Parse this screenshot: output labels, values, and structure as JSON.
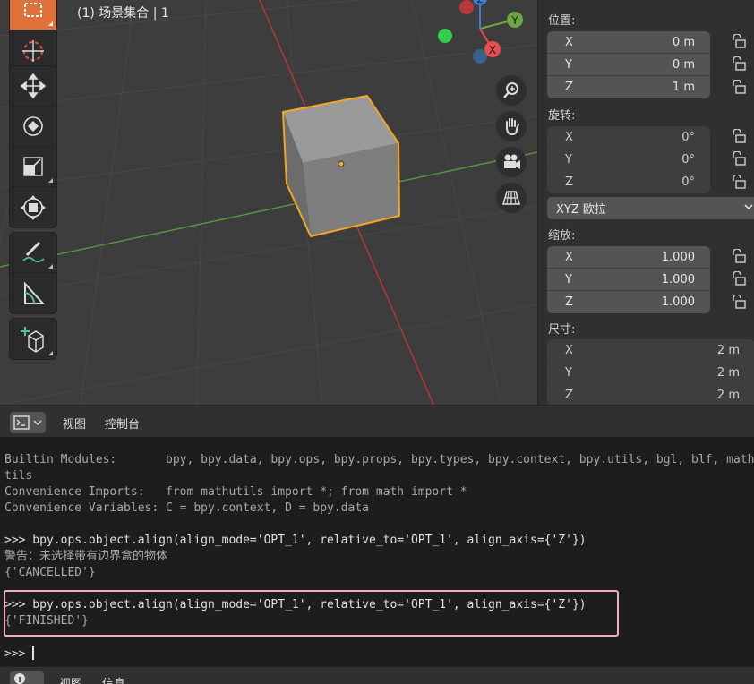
{
  "viewport": {
    "collection_label": "(1) 场景集合 | 1",
    "gizmo": {
      "x_label": "X",
      "y_label": "Y",
      "z_label": "Z"
    },
    "tools": [
      "select-box",
      "cursor",
      "move",
      "rotate",
      "scale",
      "transform",
      "annotate",
      "measure",
      "add-cube"
    ],
    "active_tool": "select-box",
    "nav_buttons": [
      "zoom",
      "pan",
      "camera",
      "perspective-toggle"
    ]
  },
  "properties": {
    "location": {
      "label": "位置:",
      "rows": [
        {
          "axis": "X",
          "value": "0 m"
        },
        {
          "axis": "Y",
          "value": "0 m"
        },
        {
          "axis": "Z",
          "value": "1 m"
        }
      ]
    },
    "rotation": {
      "label": "旋转:",
      "rows": [
        {
          "axis": "X",
          "value": "0°"
        },
        {
          "axis": "Y",
          "value": "0°"
        },
        {
          "axis": "Z",
          "value": "0°"
        }
      ],
      "mode": "XYZ 欧拉"
    },
    "scale": {
      "label": "缩放:",
      "rows": [
        {
          "axis": "X",
          "value": "1.000"
        },
        {
          "axis": "Y",
          "value": "1.000"
        },
        {
          "axis": "Z",
          "value": "1.000"
        }
      ]
    },
    "dimensions": {
      "label": "尺寸:",
      "rows": [
        {
          "axis": "X",
          "value": "2 m"
        },
        {
          "axis": "Y",
          "value": "2 m"
        },
        {
          "axis": "Z",
          "value": "2 m"
        }
      ]
    }
  },
  "console_header": {
    "menu_view": "视图",
    "menu_console": "控制台"
  },
  "console": {
    "lines": [
      {
        "kind": "output",
        "text": "Builtin Modules:       bpy, bpy.data, bpy.ops, bpy.props, bpy.types, bpy.context, bpy.utils, bgl, blf, mathu"
      },
      {
        "kind": "output",
        "text": "tils"
      },
      {
        "kind": "output",
        "text": "Convenience Imports:   from mathutils import *; from math import *"
      },
      {
        "kind": "output",
        "text": "Convenience Variables: C = bpy.context, D = bpy.data"
      },
      {
        "kind": "input",
        "text": ">>> bpy.ops.object.align(align_mode='OPT_1', relative_to='OPT_1', align_axis={'Z'})"
      },
      {
        "kind": "error",
        "text": "警告：未选择带有边界盒的物体"
      },
      {
        "kind": "error",
        "text": "{'CANCELLED'}"
      },
      {
        "kind": "input",
        "text": ">>> bpy.ops.object.align(align_mode='OPT_1', relative_to='OPT_1', align_axis={'Z'})"
      },
      {
        "kind": "error",
        "text": "{'FINISHED'}"
      }
    ],
    "prompt": ">>> "
  },
  "bottom_header": {
    "menu_view": "视图",
    "menu_info": "信息"
  },
  "colors": {
    "accent_orange": "#e0713a",
    "selection_outline": "#f5a623",
    "highlight_box": "#f4a9c8",
    "axis_x": "#e84c4c",
    "axis_y": "#6ea646",
    "axis_z": "#3b7fd6"
  }
}
